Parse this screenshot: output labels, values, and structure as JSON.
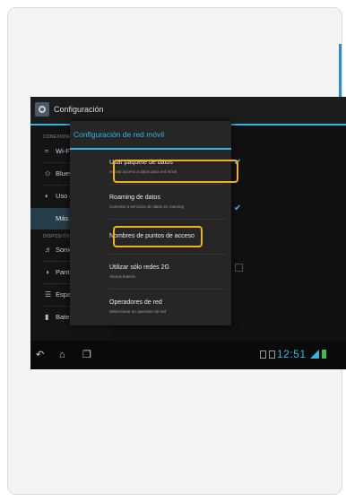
{
  "app": {
    "title": "Configuración"
  },
  "settings": {
    "sections": [
      {
        "label": "CONEXIONES INALÁMBRICAS"
      },
      {
        "label": "DISPOSITIVO"
      }
    ],
    "items": [
      {
        "label": "Wi-Fi",
        "icon": "wifi-icon"
      },
      {
        "label": "Bluetooth",
        "icon": "bluetooth-icon"
      },
      {
        "label": "Uso de datos",
        "icon": "data-usage-icon"
      },
      {
        "label": "Más..."
      },
      {
        "label": "Sonido",
        "icon": "sound-icon"
      },
      {
        "label": "Pantalla",
        "icon": "display-icon"
      },
      {
        "label": "Espacio de alma",
        "icon": "storage-icon"
      },
      {
        "label": "Batería",
        "icon": "battery-icon"
      }
    ]
  },
  "dialog": {
    "title": "Configuración de red móvil",
    "options": [
      {
        "title": "Usar paquete de datos",
        "subtitle": "Activar acceso a datos para red móvil",
        "checked": true
      },
      {
        "title": "Roaming de datos",
        "subtitle": "Conectar a servicios de datos en roaming",
        "checked": true
      },
      {
        "title": "Nombres de puntos de acceso",
        "subtitle": ""
      },
      {
        "title": "Utilizar sólo redes 2G",
        "subtitle": "Ahorra batería",
        "checked": false
      },
      {
        "title": "Operadores de red",
        "subtitle": "Seleccionar un operador de red"
      }
    ]
  },
  "statusbar": {
    "time": "12:51"
  },
  "colors": {
    "accent": "#33b5e5",
    "highlight": "#f0b021",
    "battery": "#3fb950"
  }
}
